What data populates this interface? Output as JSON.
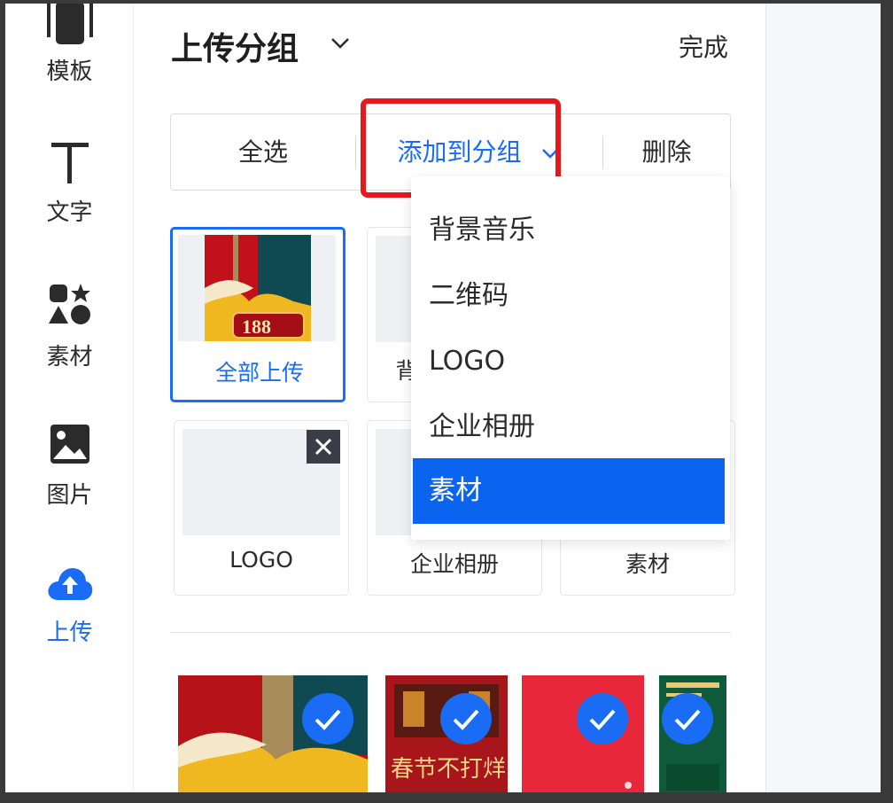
{
  "sidebar": {
    "items": [
      {
        "label": "模板",
        "icon": "template-icon"
      },
      {
        "label": "文字",
        "icon": "text-icon"
      },
      {
        "label": "素材",
        "icon": "shapes-icon"
      },
      {
        "label": "图片",
        "icon": "image-icon"
      },
      {
        "label": "上传",
        "icon": "upload-cloud-icon"
      }
    ],
    "active_index": 4
  },
  "header": {
    "title": "上传分组",
    "done_label": "完成"
  },
  "toolbar": {
    "select_all": "全选",
    "add_to_group": "添加到分组",
    "delete": "删除"
  },
  "groups": [
    {
      "label": "全部上传",
      "selected": true,
      "thumb": "festival-thumbnail"
    },
    {
      "label": "背",
      "selected": false
    },
    {
      "label": "LOGO",
      "selected": false,
      "deletable": true
    },
    {
      "label": "企业相册",
      "selected": false
    },
    {
      "label": "素材",
      "selected": false
    }
  ],
  "thumb_badge": "188",
  "dropdown": {
    "items": [
      "背景音乐",
      "二维码",
      "LOGO",
      "企业相册",
      "素材"
    ],
    "active_index": 4
  },
  "photos": {
    "count_visible": 4,
    "all_checked": true,
    "poster_text": "春节不打烊"
  },
  "colors": {
    "accent": "#1a6cf5",
    "highlight_border": "#e5191c",
    "dropdown_active": "#0a64f0"
  }
}
